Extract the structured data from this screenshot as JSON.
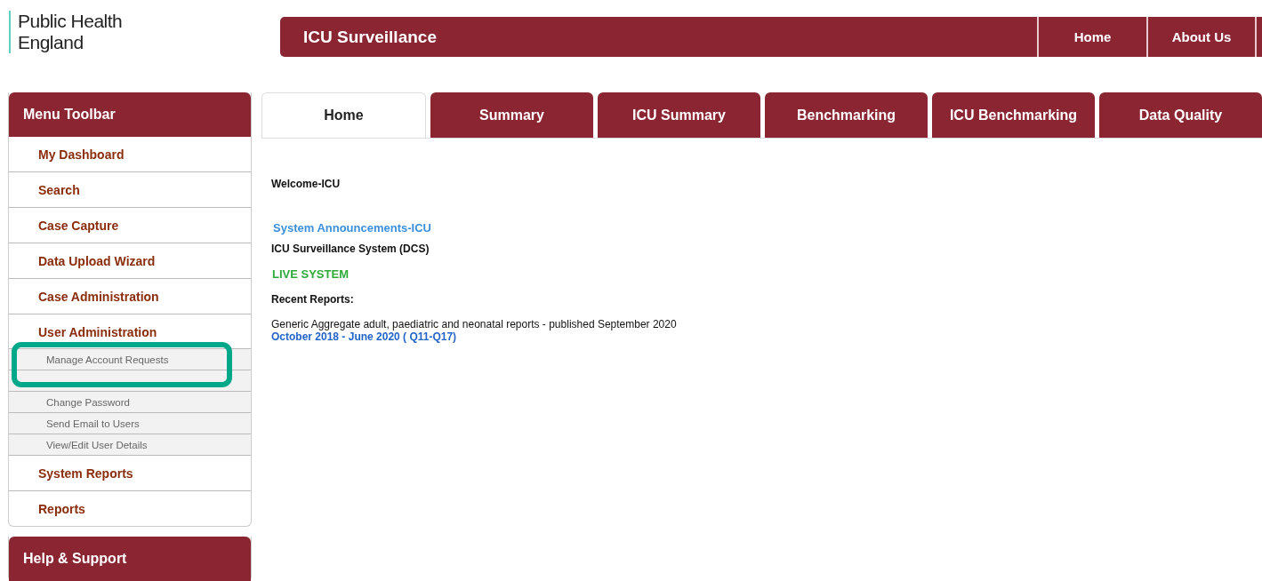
{
  "logo": {
    "lines": [
      "Public Health",
      "England"
    ]
  },
  "header": {
    "title": "ICU Surveillance",
    "links": [
      "Home",
      "About Us"
    ]
  },
  "sidebar": {
    "title": "Menu Toolbar",
    "items": [
      {
        "label": "My Dashboard"
      },
      {
        "label": "Search"
      },
      {
        "label": "Case Capture"
      },
      {
        "label": "Data Upload Wizard"
      },
      {
        "label": "Case Administration"
      },
      {
        "label": "User Administration",
        "children": [
          {
            "kind": "item",
            "label": "Manage Account Requests"
          },
          {
            "kind": "covered"
          },
          {
            "kind": "item",
            "label": "Change Password"
          },
          {
            "kind": "item",
            "label": "Send Email to Users"
          },
          {
            "kind": "item",
            "label": "View/Edit User Details"
          }
        ]
      },
      {
        "label": "System Reports"
      },
      {
        "label": "Reports"
      }
    ],
    "help_title": "Help & Support"
  },
  "tabs": [
    {
      "label": "Home",
      "selected": true
    },
    {
      "label": "Summary",
      "selected": false
    },
    {
      "label": "ICU Summary",
      "selected": false
    },
    {
      "label": "Benchmarking",
      "selected": false
    },
    {
      "label": "ICU Benchmarking",
      "selected": false
    },
    {
      "label": "Data Quality",
      "selected": false
    }
  ],
  "content": [
    {
      "kind": "heading",
      "text": "Welcome-ICU"
    },
    {
      "kind": "link",
      "text": "System Announcements-ICU"
    },
    {
      "kind": "heading",
      "text": "ICU Surveillance System (DCS)"
    },
    {
      "kind": "status",
      "text": "LIVE SYSTEM"
    },
    {
      "kind": "heading",
      "text": "Recent Reports:"
    },
    {
      "kind": "text",
      "text": "Generic Aggregate adult, paediatric and neonatal reports - published September 2020"
    },
    {
      "kind": "report-link",
      "text": "October 2018 - June 2020 ( Q11-Q17)"
    }
  ],
  "annotation": {
    "kind": "highlight-frame"
  }
}
